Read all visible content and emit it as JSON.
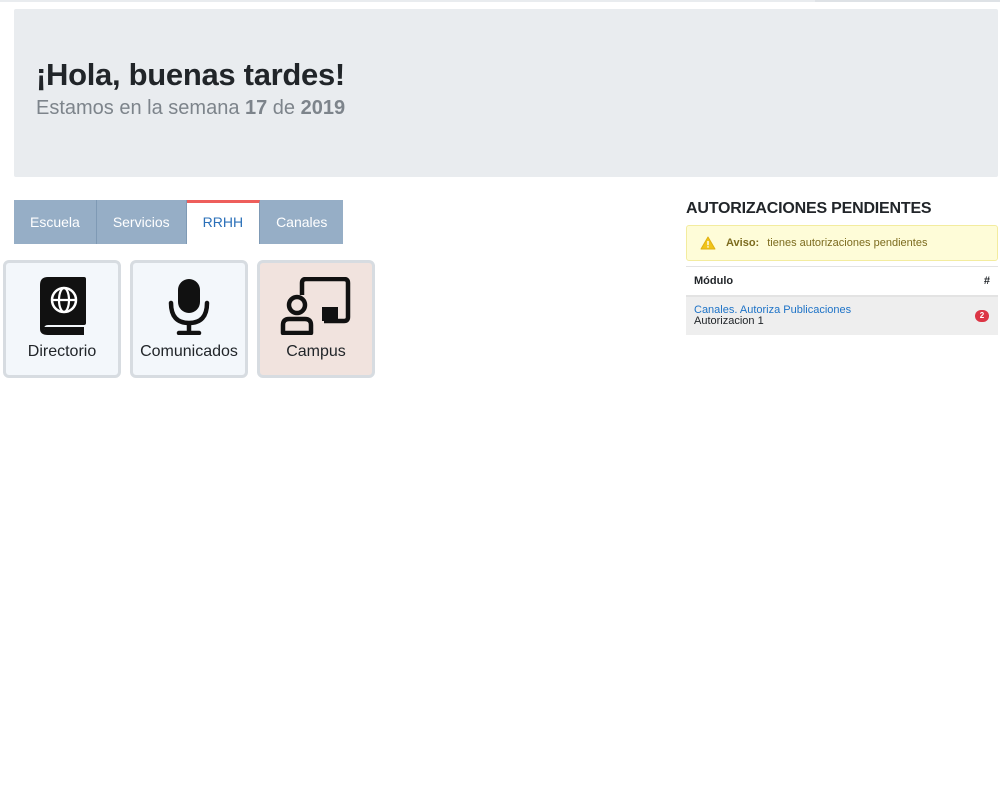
{
  "hero": {
    "greeting": "¡Hola, buenas tardes!",
    "week_prefix": "Estamos en la semana ",
    "week_number": "17",
    "week_mid": " de ",
    "year": "2019"
  },
  "tabs": [
    {
      "label": "Escuela",
      "active": false
    },
    {
      "label": "Servicios",
      "active": false
    },
    {
      "label": "RRHH",
      "active": true
    },
    {
      "label": "Canales",
      "active": false
    }
  ],
  "tiles": [
    {
      "label": "Directorio",
      "icon": "book-globe-icon"
    },
    {
      "label": "Comunicados",
      "icon": "microphone-icon"
    },
    {
      "label": "Campus",
      "icon": "presentation-icon"
    }
  ],
  "authorizations": {
    "title": "AUTORIZACIONES PENDIENTES",
    "alert": {
      "icon": "warning-icon",
      "title": "Aviso:",
      "message": "tienes autorizaciones pendientes"
    },
    "table": {
      "headers": [
        "Módulo",
        "#"
      ],
      "rows": [
        {
          "module": "Canales. Autoriza Publicaciones",
          "detail": "Autorizacion 1",
          "count": "2"
        }
      ]
    }
  },
  "colors": {
    "accent": "#ee5e5b",
    "tab_bg": "#96aec6",
    "link": "#1e73c7",
    "badge": "#dc3545"
  }
}
